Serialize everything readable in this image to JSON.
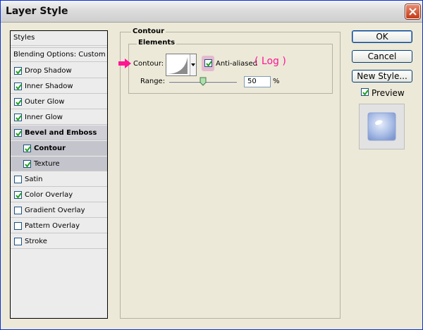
{
  "window": {
    "title": "Layer Style"
  },
  "left_panel": {
    "header": "Styles",
    "blending": "Blending Options: Custom",
    "items": [
      {
        "label": "Drop Shadow",
        "checked": true
      },
      {
        "label": "Inner Shadow",
        "checked": true
      },
      {
        "label": "Outer Glow",
        "checked": true
      },
      {
        "label": "Inner Glow",
        "checked": true
      },
      {
        "label": "Bevel and Emboss",
        "checked": true
      },
      {
        "label": "Contour",
        "checked": true
      },
      {
        "label": "Texture",
        "checked": true
      },
      {
        "label": "Satin",
        "checked": false
      },
      {
        "label": "Color Overlay",
        "checked": true
      },
      {
        "label": "Gradient Overlay",
        "checked": false
      },
      {
        "label": "Pattern Overlay",
        "checked": false
      },
      {
        "label": "Stroke",
        "checked": false
      }
    ]
  },
  "contour_panel": {
    "group_title": "Contour",
    "elements_title": "Elements",
    "contour_label": "Contour:",
    "anti_aliased_label": "Anti-aliased",
    "anti_aliased_checked": true,
    "annotation": "( Log )",
    "range_label": "Range:",
    "range_value": "50",
    "range_unit": "%"
  },
  "buttons": {
    "ok": "OK",
    "cancel": "Cancel",
    "new_style": "New Style...",
    "preview_label": "Preview",
    "preview_checked": true
  },
  "colors": {
    "annotation": "#ff1493",
    "selection": "#c4c4cc"
  }
}
